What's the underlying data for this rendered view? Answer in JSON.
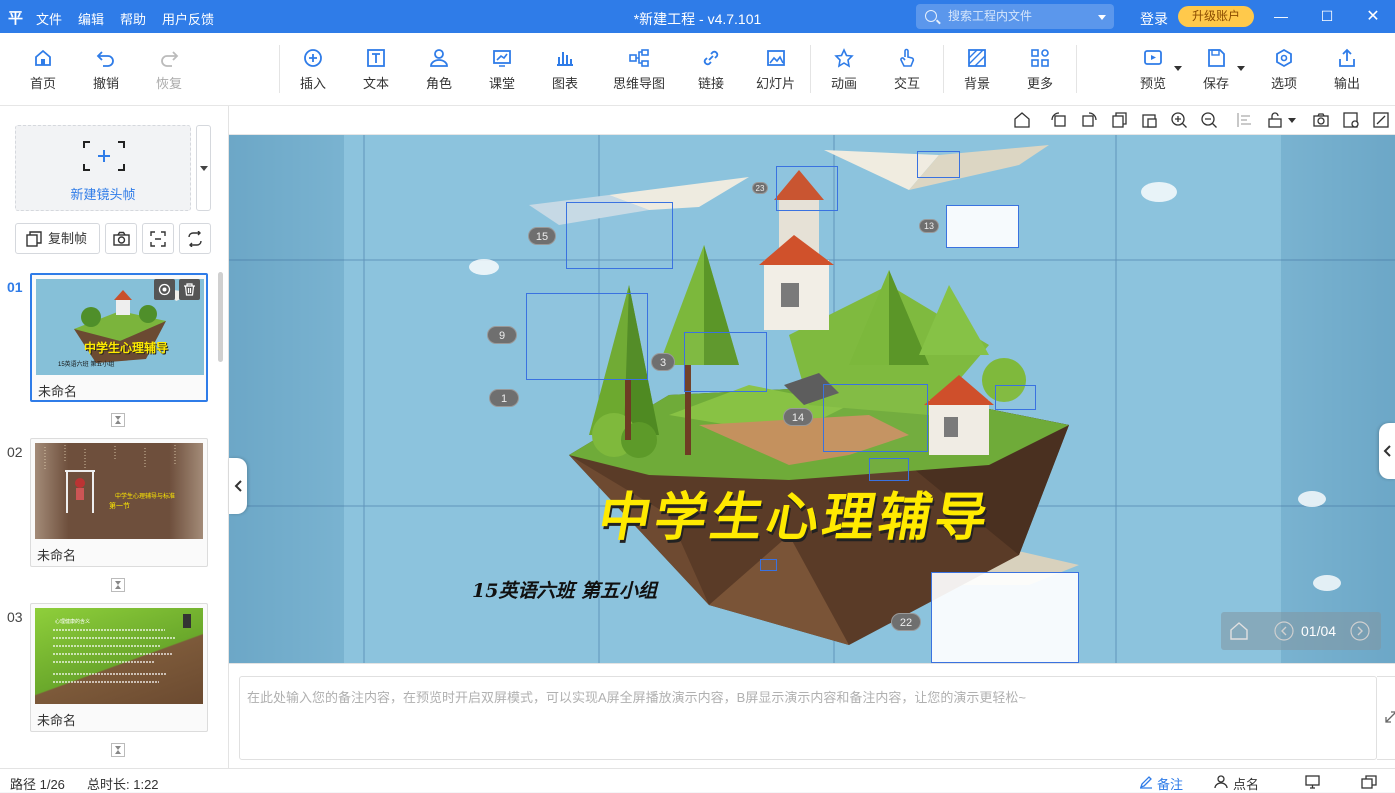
{
  "titlebar": {
    "logo": "平",
    "menu": [
      "文件",
      "编辑",
      "帮助",
      "用户反馈"
    ],
    "title": "*新建工程 - v4.7.101",
    "search_placeholder": "搜索工程内文件",
    "login": "登录",
    "upgrade": "升级账户"
  },
  "toolbar": {
    "home": "首页",
    "undo": "撤销",
    "redo": "恢复",
    "insert": "插入",
    "text": "文本",
    "role": "角色",
    "classroom": "课堂",
    "chart": "图表",
    "mindmap": "思维导图",
    "link": "链接",
    "slides": "幻灯片",
    "animation": "动画",
    "interact": "交互",
    "background": "背景",
    "more": "更多",
    "preview": "预览",
    "save": "保存",
    "options": "选项",
    "export": "输出"
  },
  "sidebar": {
    "new_frame": "新建镜头帧",
    "copy_frame": "复制帧",
    "thumbs": [
      {
        "num": "01",
        "name": "未命名",
        "title": "中学生心理辅导",
        "sub": "15英语六班 第五小组"
      },
      {
        "num": "02",
        "name": "未命名",
        "title": "中学生心理辅导与标准",
        "sub": "第一节"
      },
      {
        "num": "03",
        "name": "未命名",
        "title": "心理健康的含义"
      }
    ]
  },
  "stage": {
    "title": "中学生心理辅导",
    "subtitle": "15英语六班 第五小组",
    "markers": [
      "15",
      "23",
      "13",
      "9",
      "3",
      "1",
      "14",
      "22"
    ],
    "pager": "01/04"
  },
  "notes": {
    "placeholder": "在此处输入您的备注内容，在预览时开启双屏模式，可以实现A屏全屏播放演示内容，B屏显示演示内容和备注内容，让您的演示更轻松~"
  },
  "status": {
    "path": "路径 1/26",
    "duration": "总时长: 1:22",
    "notes_btn": "备注",
    "rollcall": "点名"
  }
}
